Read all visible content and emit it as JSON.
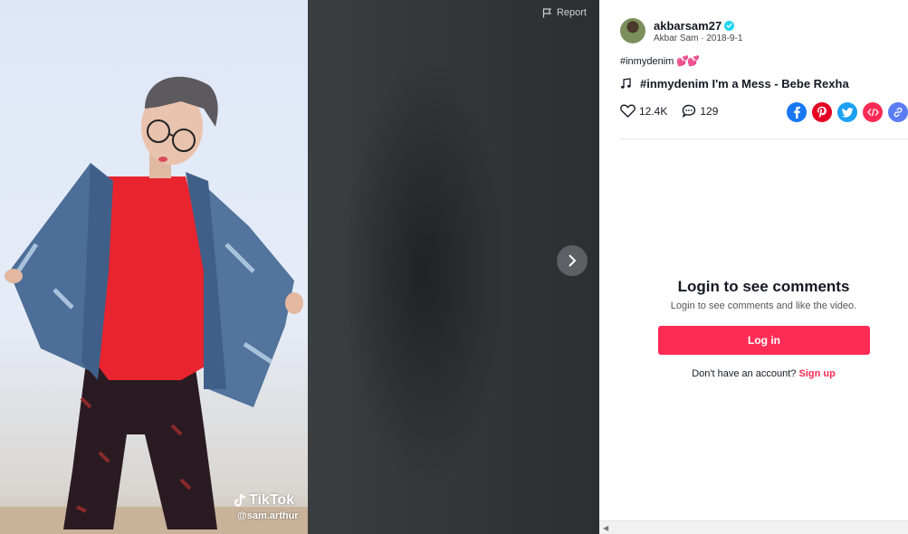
{
  "video": {
    "report_label": "Report",
    "watermark_brand": "TikTok",
    "watermark_user": "@sam.arthur"
  },
  "author": {
    "username": "akbarsam27",
    "display_name": "Akbar Sam",
    "separator": " · ",
    "date": "2018-9-1"
  },
  "post": {
    "hashtag": "#inmydenim",
    "hearts": "💕💕",
    "music_title": "#inmydenim I'm a Mess - Bebe Rexha"
  },
  "stats": {
    "likes": "12.4K",
    "comments": "129"
  },
  "share_icons": [
    "facebook-icon",
    "pinterest-icon",
    "twitter-icon",
    "embed-icon",
    "link-icon"
  ],
  "colors": {
    "accent": "#fe2c55",
    "verified": "#20d5ec",
    "facebook": "#1877f2",
    "pinterest": "#e60023",
    "twitter": "#1da1f2",
    "embed": "#fe2c55",
    "link": "#5b7cf5"
  },
  "login": {
    "title": "Login to see comments",
    "subtitle": "Login to see comments and like the video.",
    "button": "Log in",
    "no_account": "Don't have an account? ",
    "signup": "Sign up"
  }
}
